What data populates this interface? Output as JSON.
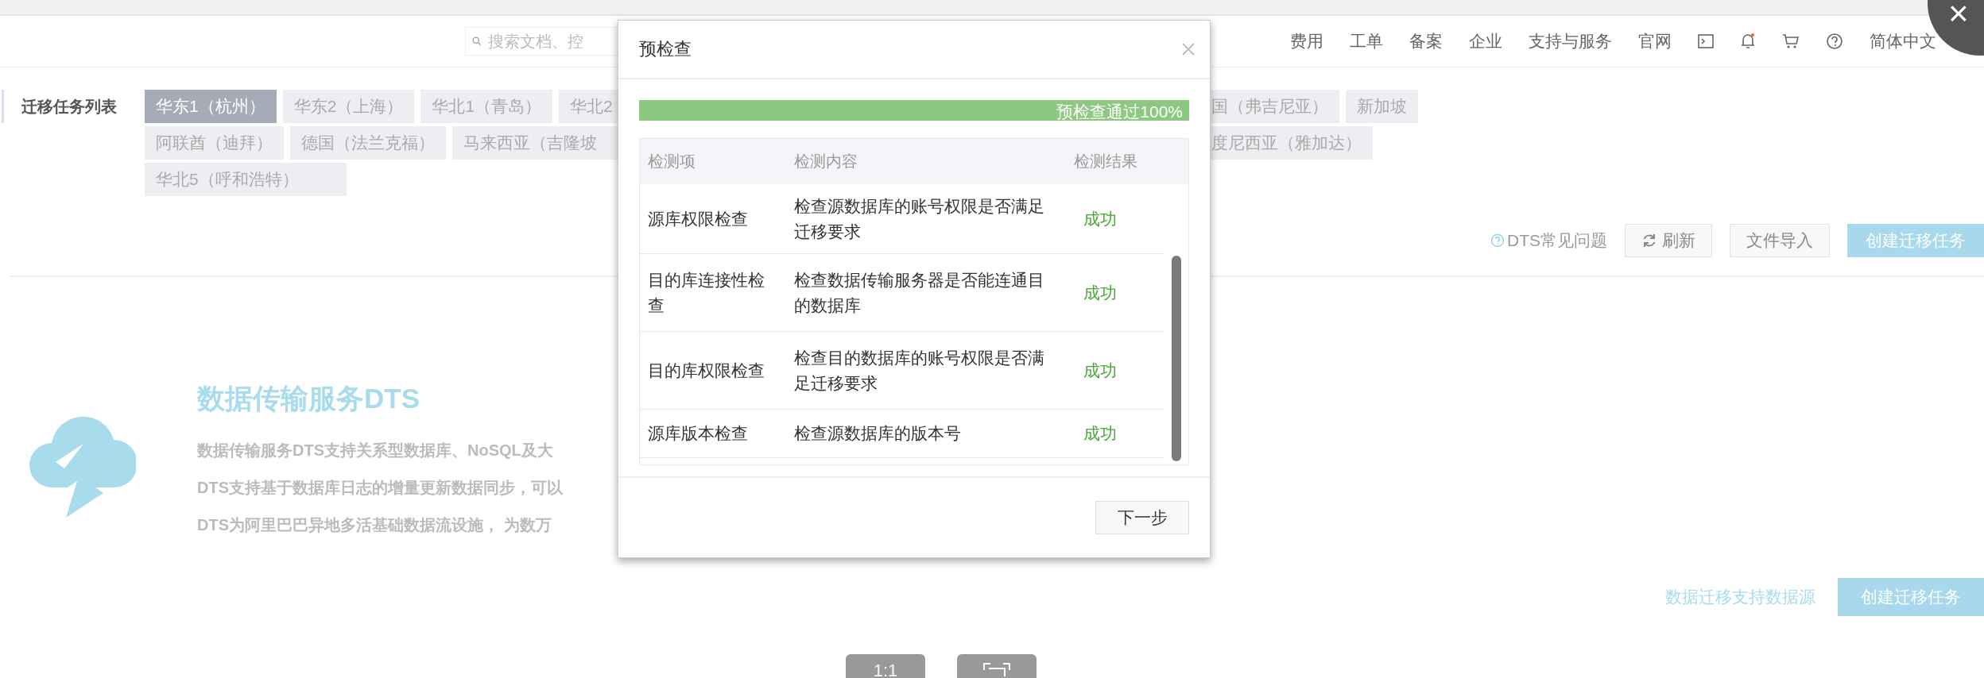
{
  "top_nav": {
    "search": {
      "placeholder": "搜索文档、控"
    },
    "links": [
      "费用",
      "工单",
      "备案",
      "企业",
      "支持与服务",
      "官网"
    ],
    "language": "简体中文"
  },
  "region_tabs": {
    "label": "迁移任务列表",
    "rows": [
      {
        "items": [
          {
            "label": "华东1（杭州）",
            "selected": true
          },
          {
            "label": "华东2（上海）",
            "selected": false
          },
          {
            "label": "华北1（青岛）",
            "selected": false
          },
          {
            "label": "华北2",
            "selected": false
          }
        ],
        "items_right": [
          {
            "label": "国（弗吉尼亚）",
            "selected": false
          },
          {
            "label": "新加坡",
            "selected": false
          }
        ]
      },
      {
        "items": [
          {
            "label": "阿联酋（迪拜）",
            "selected": false
          },
          {
            "label": "德国（法兰克福）",
            "selected": false
          },
          {
            "label": "马来西亚（吉隆坡",
            "selected": false
          }
        ],
        "items_right": [
          {
            "label": "度尼西亚（雅加达）",
            "selected": false
          }
        ]
      },
      {
        "items": [
          {
            "label": "华北5（呼和浩特）",
            "selected": false
          }
        ],
        "items_right": []
      }
    ]
  },
  "actions": {
    "faq": "DTS常见问题",
    "refresh": "刷新",
    "import": "文件导入",
    "create": "创建迁移任务"
  },
  "intro": {
    "title": "数据传输服务DTS",
    "lines": [
      "数据传输服务DTS支持关系型数据库、NoSQL及大",
      "DTS支持基于数据库日志的增量更新数据同步，可以",
      "DTS为阿里巴巴异地多活基础数据流设施， 为数万"
    ]
  },
  "bottom": {
    "link": "数据迁移支持数据源",
    "create": "创建迁移任务"
  },
  "dialog": {
    "title": "预检查",
    "progress": {
      "level": 1.0,
      "label": "预检查通过100%"
    },
    "columns": [
      "检测项",
      "检测内容",
      "检测结果"
    ],
    "rows": [
      {
        "item": "源库权限检查",
        "content": "检查源数据库的账号权限是否满足迁移要求",
        "result": "成功"
      },
      {
        "item": "目的库连接性检查",
        "content": "检查数据传输服务器是否能连通目的数据库",
        "result": "成功"
      },
      {
        "item": "目的库权限检查",
        "content": "检查目的数据库的账号权限是否满足迁移要求",
        "result": "成功"
      },
      {
        "item": "源库版本检查",
        "content": "检查源数据库的版本号",
        "result": "成功"
      }
    ],
    "next": "下一步"
  },
  "viewer": {
    "close": "×",
    "zoom_reset": "1:1"
  }
}
